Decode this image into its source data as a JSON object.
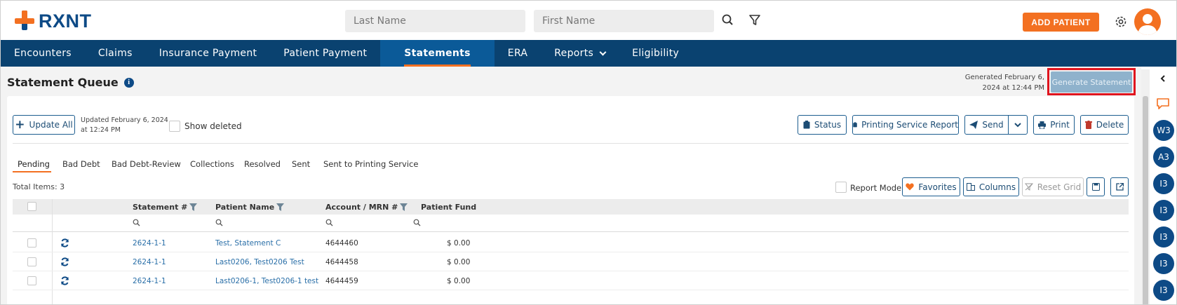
{
  "brand": {
    "name": "RXNT"
  },
  "header": {
    "last_name_placeholder": "Last Name",
    "first_name_placeholder": "First Name",
    "add_patient_label": "ADD PATIENT"
  },
  "nav": {
    "items": [
      "Encounters",
      "Claims",
      "Insurance Payment",
      "Patient Payment",
      "Statements",
      "ERA",
      "Reports",
      "Eligibility"
    ],
    "active": "Statements"
  },
  "page": {
    "title": "Statement Queue",
    "generated_note_line1": "Generated February 6,",
    "generated_note_line2": "2024 at 12:44 PM",
    "generate_label": "Generate Statement"
  },
  "toolbar": {
    "update_all_label": "Update All",
    "updated_line1": "Updated February 6, 2024",
    "updated_line2": "at 12:24 PM",
    "show_deleted_label": "Show deleted",
    "status_label": "Status",
    "printing_report_label": "Printing Service Report",
    "send_label": "Send",
    "print_label": "Print",
    "delete_label": "Delete"
  },
  "tabs": {
    "items": [
      "Pending",
      "Bad Debt",
      "Bad Debt-Review",
      "Collections",
      "Resolved",
      "Sent",
      "Sent to Printing Service"
    ],
    "active": "Pending"
  },
  "grid": {
    "total_items_label": "Total Items: 3",
    "report_mode_label": "Report Mode",
    "favorites_label": "Favorites",
    "columns_label": "Columns",
    "reset_grid_label": "Reset Grid",
    "columns": [
      "Statement #",
      "Patient Name",
      "Account / MRN #",
      "Patient Fund"
    ],
    "rows": [
      {
        "statement": "2624-1-1",
        "patient": "Test, Statement C",
        "account": "4644460",
        "fund": "$ 0.00"
      },
      {
        "statement": "2624-1-1",
        "patient": "Last0206, Test0206 Test",
        "account": "4644458",
        "fund": "$ 0.00"
      },
      {
        "statement": "2624-1-1",
        "patient": "Last0206-1, Test0206-1 test",
        "account": "4644459",
        "fund": "$ 0.00"
      }
    ]
  },
  "rail": {
    "badges": [
      "W3",
      "A3",
      "I3",
      "I3",
      "I3",
      "I3",
      "I3"
    ]
  },
  "colors": {
    "brand_orange": "#f37021",
    "nav_blue": "#0a4270",
    "highlight_red": "#e0141e"
  }
}
